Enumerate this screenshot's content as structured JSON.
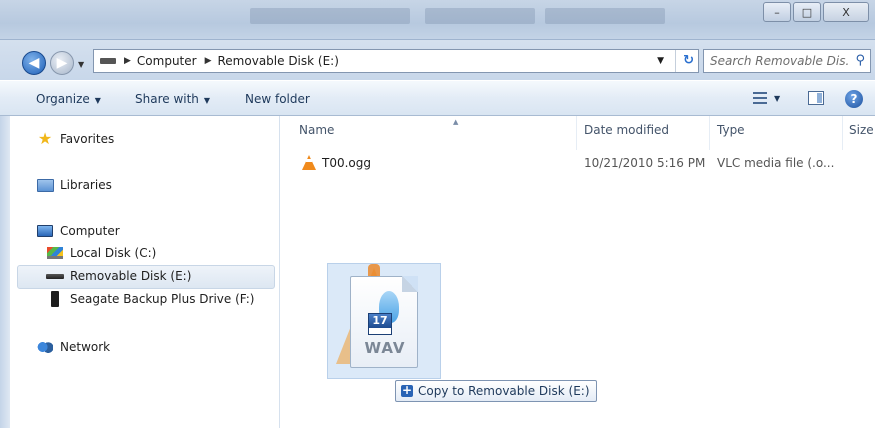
{
  "titlebar": {
    "minimize": "–",
    "maximize": "□",
    "close": "X"
  },
  "address": {
    "crumbs": [
      "Computer",
      "Removable Disk (E:)"
    ],
    "search_placeholder": "Search Removable Dis..."
  },
  "toolbar": {
    "organize": "Organize",
    "share_with": "Share with",
    "new_folder": "New folder",
    "help": "?"
  },
  "nav": {
    "favorites": "Favorites",
    "libraries": "Libraries",
    "computer": "Computer",
    "local_disk": "Local Disk (C:)",
    "removable_disk": "Removable Disk (E:)",
    "seagate": "Seagate Backup Plus Drive (F:)",
    "network": "Network"
  },
  "columns": {
    "name": "Name",
    "date": "Date modified",
    "type": "Type",
    "size": "Size"
  },
  "files": [
    {
      "name": "T00.ogg",
      "date": "10/21/2010 5:16 PM",
      "type": "VLC media file (.o..."
    }
  ],
  "drag": {
    "calendar_num": "17",
    "file_label": "WAV",
    "tooltip": "Copy to Removable Disk (E:)",
    "plus": "+"
  }
}
